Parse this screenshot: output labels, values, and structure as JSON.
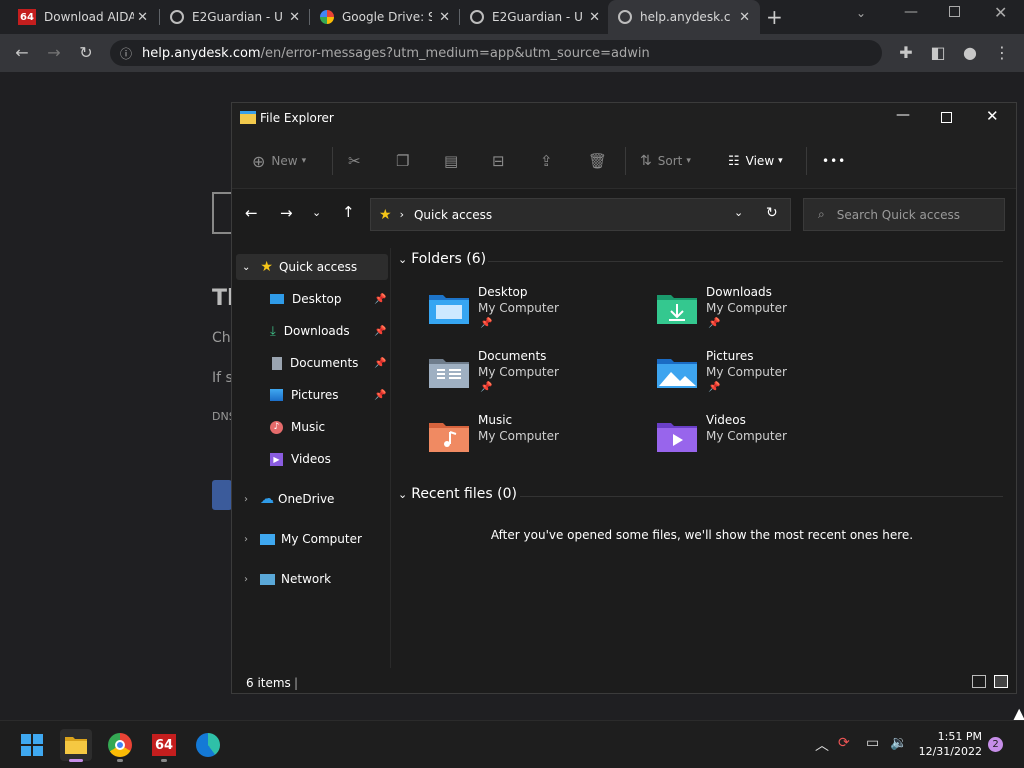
{
  "browser": {
    "tabs": [
      {
        "title": "Download AIDA",
        "icon": "aida64-icon"
      },
      {
        "title": "E2Guardian - U",
        "icon": "globe-icon"
      },
      {
        "title": "Google Drive: S",
        "icon": "google-icon"
      },
      {
        "title": "E2Guardian - U",
        "icon": "globe-icon"
      },
      {
        "title": "help.anydesk.co",
        "icon": "globe-icon"
      }
    ],
    "new_tab": "+",
    "url": "help.anydesk.com/en/error-messages?utm_medium=app&utm_source=adwin",
    "url_host": "help.anydesk.com",
    "url_path": "/en/error-messages?utm_medium=app&utm_source=adwin"
  },
  "page_bg_fragments": {
    "heading": "Th",
    "line1": "Che",
    "line2": "If s",
    "line3": "DNS"
  },
  "explorer": {
    "title": "File Explorer",
    "toolbar": {
      "new": "New",
      "sort": "Sort",
      "view": "View",
      "more": "•••"
    },
    "breadcrumb": "Quick access",
    "search_placeholder": "Search Quick access",
    "sidebar": {
      "quick_access": "Quick access",
      "items": [
        {
          "label": "Desktop",
          "pinned": true
        },
        {
          "label": "Downloads",
          "pinned": true
        },
        {
          "label": "Documents",
          "pinned": true
        },
        {
          "label": "Pictures",
          "pinned": true
        },
        {
          "label": "Music",
          "pinned": false
        },
        {
          "label": "Videos",
          "pinned": false
        }
      ],
      "onedrive": "OneDrive",
      "my_computer": "My Computer",
      "network": "Network"
    },
    "folders_header": "Folders (6)",
    "folders": [
      {
        "name": "Desktop",
        "location": "My Computer",
        "pinned": true
      },
      {
        "name": "Downloads",
        "location": "My Computer",
        "pinned": true
      },
      {
        "name": "Documents",
        "location": "My Computer",
        "pinned": true
      },
      {
        "name": "Pictures",
        "location": "My Computer",
        "pinned": true
      },
      {
        "name": "Music",
        "location": "My Computer",
        "pinned": false
      },
      {
        "name": "Videos",
        "location": "My Computer",
        "pinned": false
      }
    ],
    "recent_header": "Recent files (0)",
    "recent_empty": "After you've opened some files, we'll show the most recent ones here.",
    "status": "6 items"
  },
  "taskbar": {
    "time": "1:51 PM",
    "date": "12/31/2022",
    "notifications": "2",
    "aida_label": "64"
  },
  "colors": {
    "chrome_bg": "#202124",
    "explorer_bg": "#1c1c1c",
    "accent_star": "#f5c518",
    "notification_badge": "#c68ee8"
  }
}
